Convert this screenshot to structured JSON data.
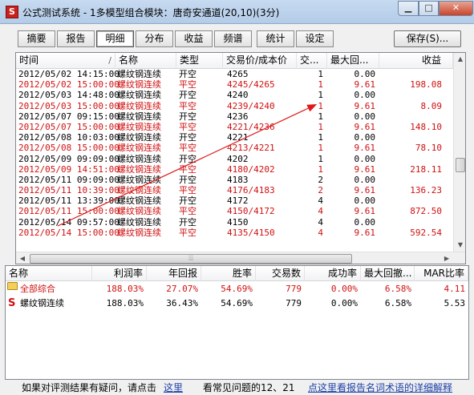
{
  "window": {
    "title": "公式测试系统 - 1多模型组合模块：唐奇安通道(20,10)(3分)",
    "min_symbol": "▁",
    "max_symbol": "□",
    "close_symbol": "✕",
    "icon_letter": "S"
  },
  "tabs": [
    {
      "label": "摘要"
    },
    {
      "label": "报告"
    },
    {
      "label": "明细"
    },
    {
      "label": "分布"
    },
    {
      "label": "收益"
    },
    {
      "label": "频谱"
    },
    {
      "label": "统计"
    },
    {
      "label": "设定"
    }
  ],
  "active_tab": "明细",
  "save_button": "保存(S)...",
  "detail_table": {
    "columns": [
      "时间",
      "名称",
      "类型",
      "交易价/成本价",
      "交...",
      "最大回...",
      "收益"
    ],
    "sort_indicator": "/",
    "rows": [
      {
        "time": "2012/05/02 14:15:00",
        "name": "螺纹钢连续",
        "type": "开空",
        "price": "4265",
        "qty": "1",
        "mdd": "0.00",
        "pnl": "",
        "red": false
      },
      {
        "time": "2012/05/02 15:00:00",
        "name": "螺纹钢连续",
        "type": "平空",
        "price": "4245/4265",
        "qty": "1",
        "mdd": "9.61",
        "pnl": "198.08",
        "red": true
      },
      {
        "time": "2012/05/03 14:48:00",
        "name": "螺纹钢连续",
        "type": "开空",
        "price": "4240",
        "qty": "1",
        "mdd": "0.00",
        "pnl": "",
        "red": false
      },
      {
        "time": "2012/05/03 15:00:00",
        "name": "螺纹钢连续",
        "type": "平空",
        "price": "4239/4240",
        "qty": "1",
        "mdd": "9.61",
        "pnl": "8.09",
        "red": true
      },
      {
        "time": "2012/05/07 09:15:00",
        "name": "螺纹钢连续",
        "type": "开空",
        "price": "4236",
        "qty": "1",
        "mdd": "0.00",
        "pnl": "",
        "red": false
      },
      {
        "time": "2012/05/07 15:00:00",
        "name": "螺纹钢连续",
        "type": "平空",
        "price": "4221/4236",
        "qty": "1",
        "mdd": "9.61",
        "pnl": "148.10",
        "red": true
      },
      {
        "time": "2012/05/08 10:03:00",
        "name": "螺纹钢连续",
        "type": "开空",
        "price": "4221",
        "qty": "1",
        "mdd": "0.00",
        "pnl": "",
        "red": false
      },
      {
        "time": "2012/05/08 15:00:00",
        "name": "螺纹钢连续",
        "type": "平空",
        "price": "4213/4221",
        "qty": "1",
        "mdd": "9.61",
        "pnl": "78.10",
        "red": true
      },
      {
        "time": "2012/05/09 09:09:00",
        "name": "螺纹钢连续",
        "type": "开空",
        "price": "4202",
        "qty": "1",
        "mdd": "0.00",
        "pnl": "",
        "red": false
      },
      {
        "time": "2012/05/09 14:51:00",
        "name": "螺纹钢连续",
        "type": "平空",
        "price": "4180/4202",
        "qty": "1",
        "mdd": "9.61",
        "pnl": "218.11",
        "red": true
      },
      {
        "time": "2012/05/11 09:09:00",
        "name": "螺纹钢连续",
        "type": "开空",
        "price": "4183",
        "qty": "2",
        "mdd": "0.00",
        "pnl": "",
        "red": false
      },
      {
        "time": "2012/05/11 10:39:00",
        "name": "螺纹钢连续",
        "type": "平空",
        "price": "4176/4183",
        "qty": "2",
        "mdd": "9.61",
        "pnl": "136.23",
        "red": true
      },
      {
        "time": "2012/05/11 13:39:00",
        "name": "螺纹钢连续",
        "type": "开空",
        "price": "4172",
        "qty": "4",
        "mdd": "0.00",
        "pnl": "",
        "red": false
      },
      {
        "time": "2012/05/11 15:00:00",
        "name": "螺纹钢连续",
        "type": "平空",
        "price": "4150/4172",
        "qty": "4",
        "mdd": "9.61",
        "pnl": "872.50",
        "red": true
      },
      {
        "time": "2012/05/14 09:57:00",
        "name": "螺纹钢连续",
        "type": "开空",
        "price": "4150",
        "qty": "4",
        "mdd": "0.00",
        "pnl": "",
        "red": false
      },
      {
        "time": "2012/05/14 15:00:00",
        "name": "螺纹钢连续",
        "type": "平空",
        "price": "4135/4150",
        "qty": "4",
        "mdd": "9.61",
        "pnl": "592.54",
        "red": true
      }
    ]
  },
  "summary_table": {
    "columns": [
      "名称",
      "利润率",
      "年回报",
      "胜率",
      "交易数",
      "成功率",
      "最大回撤...",
      "MAR比率"
    ],
    "rows": [
      {
        "icon": "folder-icon",
        "name": "全部综合",
        "profit_rate": "188.03%",
        "annual": "27.07%",
        "win_rate": "54.69%",
        "trades": "779",
        "success": "0.00%",
        "max_dd": "6.58%",
        "mar": "4.11",
        "red": true
      },
      {
        "icon": "s-icon",
        "name": "螺纹钢连续",
        "profit_rate": "188.03%",
        "annual": "36.43%",
        "win_rate": "54.69%",
        "trades": "779",
        "success": "0.00%",
        "max_dd": "6.58%",
        "mar": "5.53",
        "red": false
      }
    ]
  },
  "status_bar": {
    "prefix": "如果对评测结果有疑问，请点击",
    "link1": "这里",
    "middle": "看常见问题的12、21",
    "link2": "点这里看报告名词术语的详细解释"
  },
  "colors": {
    "accent_red": "#d01010",
    "link_blue": "#1b3fa8",
    "window_frame": "#b9d1ea"
  }
}
